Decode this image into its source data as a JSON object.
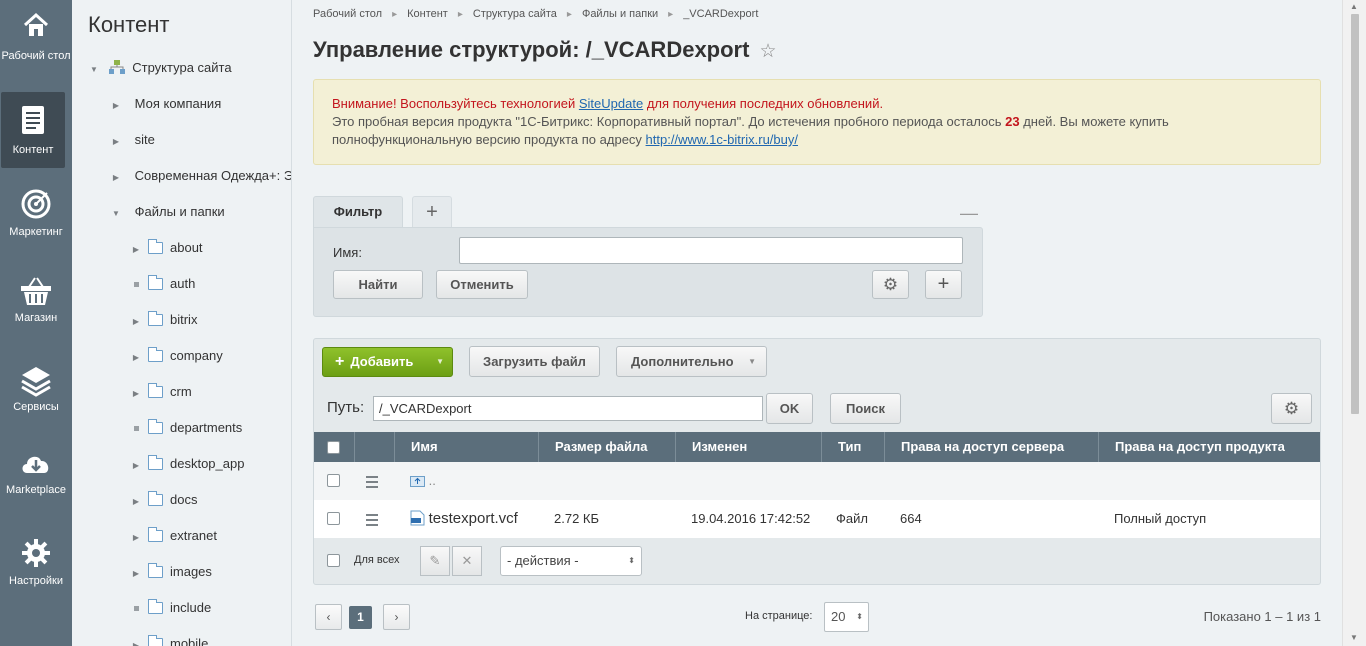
{
  "left_menu": [
    {
      "label": "Рабочий стол",
      "icon": "home-icon",
      "active": false
    },
    {
      "label": "Контент",
      "icon": "document-icon",
      "active": true
    },
    {
      "label": "Маркетинг",
      "icon": "target-icon",
      "active": false
    },
    {
      "label": "Магазин",
      "icon": "basket-icon",
      "active": false
    },
    {
      "label": "Сервисы",
      "icon": "layers-icon",
      "active": false
    },
    {
      "label": "Marketplace",
      "icon": "cloud-download-icon",
      "active": false
    },
    {
      "label": "Настройки",
      "icon": "gear-icon",
      "active": false
    }
  ],
  "tree": {
    "title": "Контент",
    "root": "Структура сайта",
    "items": [
      "Моя компания",
      "site",
      "Современная Одежда+: Эл",
      "Файлы и папки"
    ],
    "folders": [
      "about",
      "auth",
      "bitrix",
      "company",
      "crm",
      "departments",
      "desktop_app",
      "docs",
      "extranet",
      "images",
      "include",
      "mobile"
    ]
  },
  "breadcrumbs": [
    "Рабочий стол",
    "Контент",
    "Структура сайта",
    "Файлы и папки",
    "_VCARDexport"
  ],
  "page_title": "Управление структурой: /_VCARDexport",
  "notice": {
    "warn_prefix": "Внимание! Воспользуйтесь технологией ",
    "link_siteupdate": "SiteUpdate",
    "warn_suffix": " для получения последних обновлений.",
    "trial_text_1": "Это пробная версия продукта \"1С-Битрикс: Корпоративный портал\". До истечения пробного периода осталось ",
    "days": "23",
    "trial_text_2": " дней. Вы можете купить",
    "trial_text_3": "полнофункциональную версию продукта по адресу ",
    "buy_link": "http://www.1c-bitrix.ru/buy/"
  },
  "filter": {
    "tab_label": "Фильтр",
    "add_tab": "+",
    "name_label": "Имя:",
    "name_value": "",
    "find_button": "Найти",
    "cancel_button": "Отменить",
    "minimize": "—"
  },
  "toolbar": {
    "add_button": "Добавить",
    "upload_button": "Загрузить файл",
    "more_button": "Дополнительно"
  },
  "path": {
    "label": "Путь:",
    "value": "/_VCARDexport",
    "ok_button": "OK",
    "search_button": "Поиск"
  },
  "table": {
    "columns": [
      "Имя",
      "Размер файла",
      "Изменен",
      "Тип",
      "Права на доступ сервера",
      "Права на доступ продукта"
    ],
    "up_row": "..",
    "rows": [
      {
        "name": "testexport.vcf",
        "size": "2.72 КБ",
        "modified": "19.04.2016 17:42:52",
        "type": "Файл",
        "server_rights": "664",
        "product_rights": "Полный доступ"
      }
    ]
  },
  "footer": {
    "for_all_label": "Для всех",
    "actions_select": "- действия -"
  },
  "pager": {
    "current_page": "1",
    "per_page_label": "На странице:",
    "per_page_value": "20",
    "shown_text": "Показано 1 – 1 из 1"
  }
}
